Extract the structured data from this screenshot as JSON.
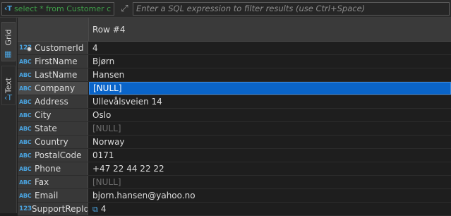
{
  "filter_bar": {
    "sql_text": "select * from Customer c",
    "sql_icon": "sql-script-icon",
    "expand_icon": "expand-icon",
    "filter_placeholder": "Enter a SQL expression to filter results (use Ctrl+Space)"
  },
  "sidebar": {
    "tabs": [
      {
        "label": "Grid",
        "icon": "grid-icon"
      },
      {
        "label": "Text",
        "icon": "text-icon"
      }
    ]
  },
  "grid": {
    "column_header": "Row #4",
    "rows": [
      {
        "type": "123",
        "name": "CustomerId",
        "value": "4",
        "null": false,
        "key": true
      },
      {
        "type": "ABC",
        "name": "FirstName",
        "value": "Bjørn",
        "null": false
      },
      {
        "type": "ABC",
        "name": "LastName",
        "value": "Hansen",
        "null": false
      },
      {
        "type": "ABC",
        "name": "Company",
        "value": "[NULL]",
        "null": false,
        "selected": true
      },
      {
        "type": "ABC",
        "name": "Address",
        "value": "Ullevålsveien 14",
        "null": false
      },
      {
        "type": "ABC",
        "name": "City",
        "value": "Oslo",
        "null": false
      },
      {
        "type": "ABC",
        "name": "State",
        "value": "[NULL]",
        "null": true
      },
      {
        "type": "ABC",
        "name": "Country",
        "value": "Norway",
        "null": false
      },
      {
        "type": "ABC",
        "name": "PostalCode",
        "value": "0171",
        "null": false
      },
      {
        "type": "ABC",
        "name": "Phone",
        "value": "+47 22 44 22 22",
        "null": false
      },
      {
        "type": "ABC",
        "name": "Fax",
        "value": "[NULL]",
        "null": true
      },
      {
        "type": "ABC",
        "name": "Email",
        "value": "bjorn.hansen@yahoo.no",
        "null": false
      },
      {
        "type": "123",
        "name": "SupportRepId",
        "value": "4",
        "null": false,
        "link": true
      }
    ]
  },
  "colors": {
    "selection": "#0a64c8",
    "type_icon": "#4aa3df",
    "sql_text": "#3f9e49",
    "null_text": "#6e6e6e"
  }
}
